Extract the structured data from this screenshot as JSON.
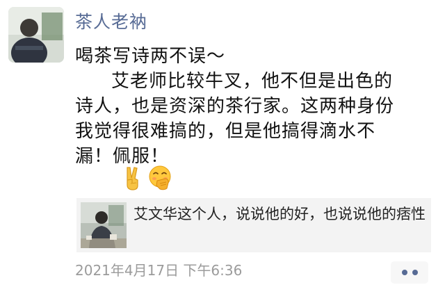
{
  "post": {
    "author": "茶人老衲",
    "lines": [
      "喝茶写诗两不误～",
      "艾老师比较牛叉，他不但是出色的",
      "诗人，也是资深的茶行家。这两种身份",
      "我觉得很难搞的，但是他搞得滴水不",
      "漏！佩服！"
    ],
    "emojis": [
      "victory-hand-icon",
      "smiling-face-with-hand-over-mouth-icon"
    ],
    "link": {
      "title": "艾文华这个人，说说他的好，也说说他的痞性"
    },
    "timestamp": "2021年4月17日 下午6:36"
  }
}
